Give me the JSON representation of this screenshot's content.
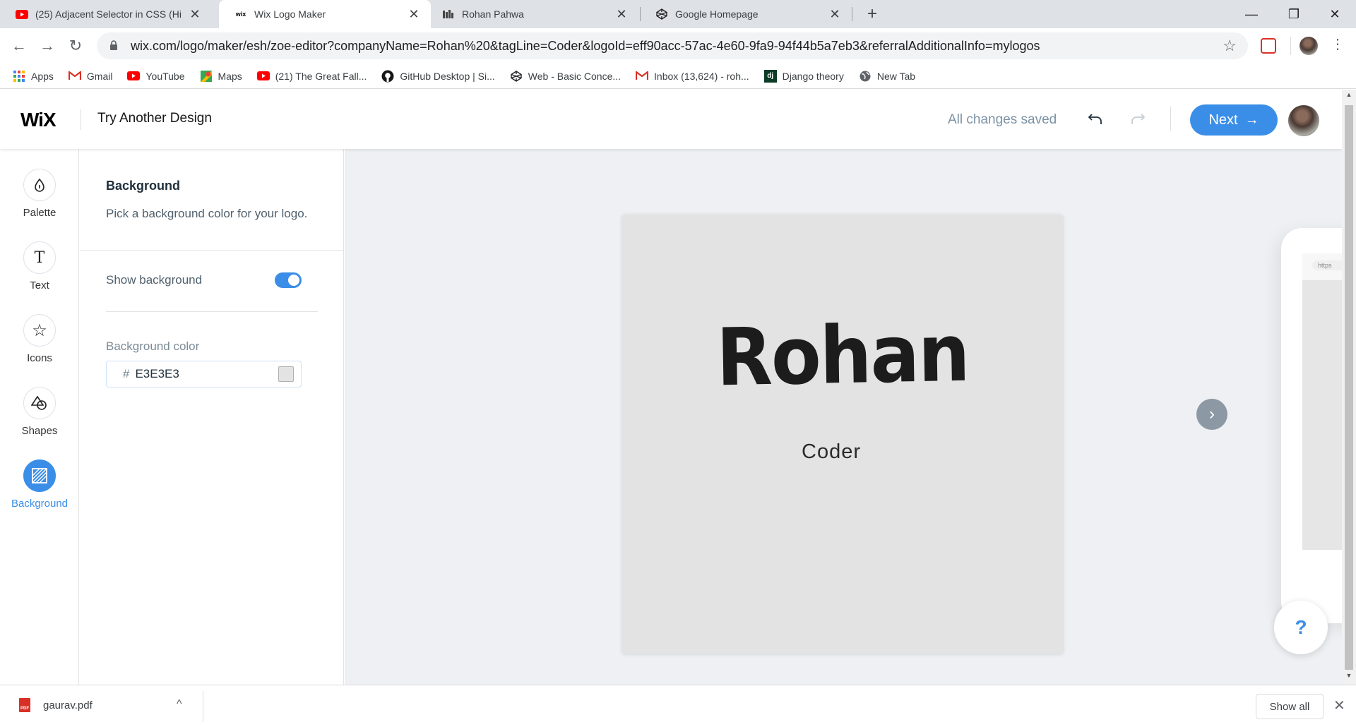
{
  "browser": {
    "tabs": [
      {
        "label": "(25) Adjacent Selector in CSS (Hi",
        "favicon": "youtube-icon",
        "close": "✕"
      },
      {
        "label": "Wix Logo Maker",
        "favicon": "wix-icon",
        "favicon_text": "wix",
        "close": "✕"
      },
      {
        "label": "Rohan Pahwa",
        "favicon": "site-icon",
        "close": "✕"
      },
      {
        "label": "Google Homepage",
        "favicon": "codepen-icon",
        "close": "✕"
      }
    ],
    "new_tab": "+",
    "window_controls": {
      "minimize": "—",
      "restore": "❐",
      "close": "✕"
    },
    "nav": {
      "back": "←",
      "forward": "→",
      "reload": "↻"
    },
    "url": "wix.com/logo/maker/esh/zoe-editor?companyName=Rohan%20&tagLine=Coder&logoId=eff90acc-57ac-4e60-9fa9-94f44b5a7eb3&referralAdditionalInfo=mylogos",
    "bookmarks": [
      {
        "label": "Apps",
        "icon": "apps-grid-icon"
      },
      {
        "label": "Gmail",
        "icon": "gmail-icon"
      },
      {
        "label": "YouTube",
        "icon": "youtube-icon"
      },
      {
        "label": "Maps",
        "icon": "maps-icon"
      },
      {
        "label": "(21) The Great Fall...",
        "icon": "youtube-icon"
      },
      {
        "label": "GitHub Desktop | Si...",
        "icon": "github-icon"
      },
      {
        "label": "Web - Basic Conce...",
        "icon": "codepen-icon"
      },
      {
        "label": "Inbox (13,624) - roh...",
        "icon": "gmail-icon"
      },
      {
        "label": "Django theory",
        "icon": "django-icon",
        "icon_text": "dj"
      },
      {
        "label": "New Tab",
        "icon": "globe-icon"
      }
    ]
  },
  "header": {
    "logo": "WiX",
    "try_another": "Try Another Design",
    "status": "All changes saved",
    "next_label": "Next",
    "next_arrow": "→"
  },
  "tools": [
    {
      "label": "Palette",
      "icon": "palette-drop-icon",
      "glyph": "◈"
    },
    {
      "label": "Text",
      "icon": "text-t-icon",
      "glyph": "T"
    },
    {
      "label": "Icons",
      "icon": "star-icon",
      "glyph": "☆"
    },
    {
      "label": "Shapes",
      "icon": "shapes-icon",
      "glyph": "△"
    },
    {
      "label": "Background",
      "icon": "background-hatch-icon",
      "glyph": "▨"
    }
  ],
  "panel": {
    "title": "Background",
    "description": "Pick a background color for your logo.",
    "show_background_label": "Show background",
    "show_background": true,
    "bg_color_label": "Background color",
    "hash": "#",
    "bg_color_value": "E3E3E3"
  },
  "logo": {
    "name": "Rohan",
    "tagline": "Coder",
    "background_color": "#E3E3E3"
  },
  "mockup": {
    "url_text": "https"
  },
  "help": "?",
  "downloads": {
    "file": "gaurav.pdf",
    "file_icon_text": "PDF",
    "chevron": "^",
    "show_all": "Show all",
    "close": "✕"
  },
  "colors": {
    "accent": "#3B8EE8",
    "canvas": "#EEF0F3"
  }
}
